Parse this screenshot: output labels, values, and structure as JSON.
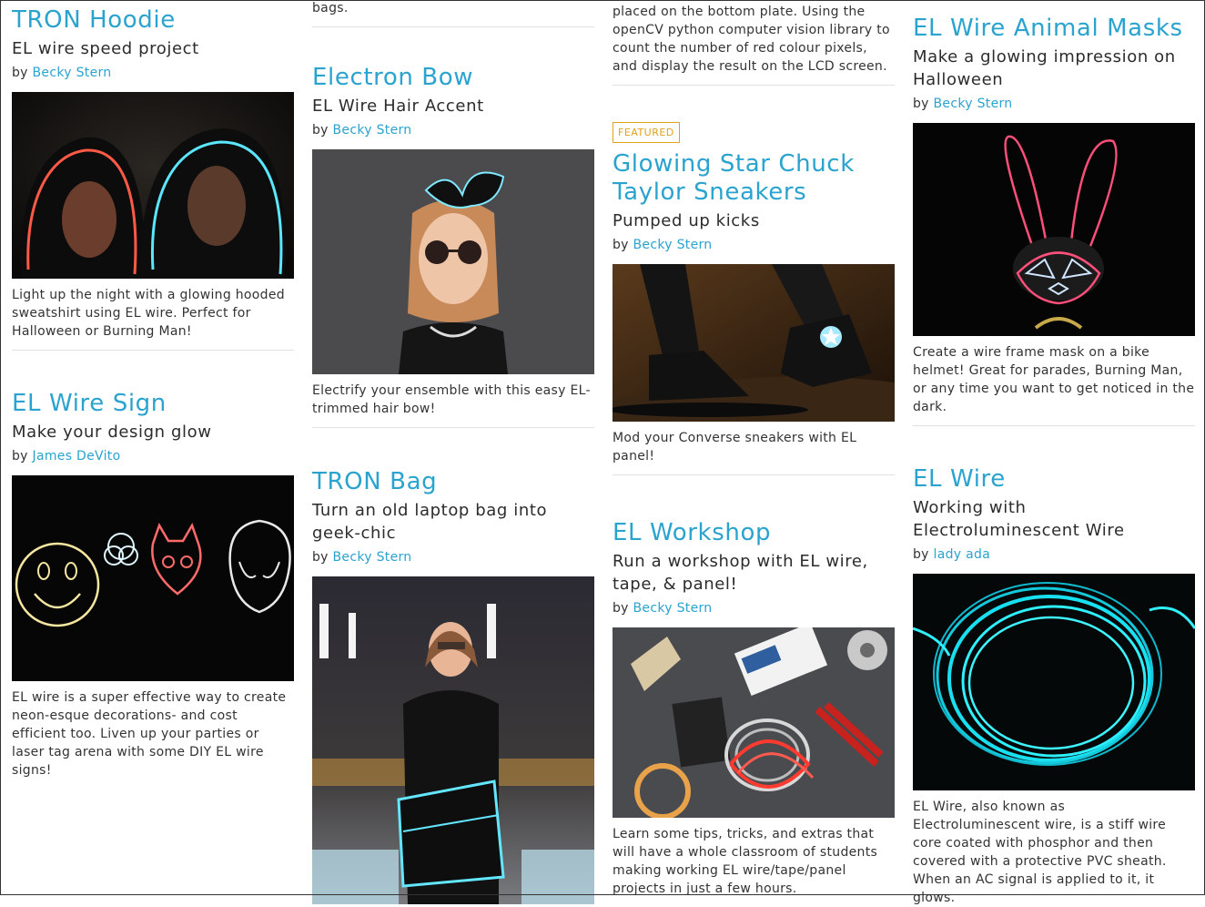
{
  "col1": {
    "card1": {
      "title": "TRON Hoodie",
      "subtitle": "EL wire speed project",
      "by": "by ",
      "author": "Becky Stern",
      "photo": "tron-hoodie-photo",
      "desc": "Light up the night with a glowing hooded sweatshirt using EL wire. Perfect for Halloween or Burning Man!"
    },
    "card2": {
      "title": "EL Wire Sign",
      "subtitle": "Make your design glow",
      "by": "by ",
      "author": "James DeVito",
      "photo": "el-wire-sign-photo",
      "desc": "EL wire is a super effective way to create neon-esque decorations- and cost efficient too. Liven up your parties or laser tag arena with some DIY EL wire signs!"
    }
  },
  "col2": {
    "top_fragment": "bags.",
    "card1": {
      "title": "Electron Bow",
      "subtitle": "EL Wire Hair Accent",
      "by": "by ",
      "author": "Becky Stern",
      "photo": "electron-bow-photo",
      "desc": "Electrify your ensemble with this easy EL-trimmed hair bow!"
    },
    "card2": {
      "title": "TRON Bag",
      "subtitle": "Turn an old laptop bag into geek-chic",
      "by": "by ",
      "author": "Becky Stern",
      "photo": "tron-bag-photo"
    }
  },
  "col3": {
    "top_fragment": "placed on the bottom plate. Using the openCV python computer vision library to count the number of red colour pixels, and display the result on the LCD screen.",
    "card1": {
      "badge": "FEATURED",
      "title": "Glowing Star Chuck Taylor Sneakers",
      "subtitle": "Pumped up kicks",
      "by": "by ",
      "author": "Becky Stern",
      "photo": "sneakers-photo",
      "desc": "Mod your Converse sneakers with EL panel!"
    },
    "card2": {
      "title": "EL Workshop",
      "subtitle": "Run a workshop with EL wire, tape, & panel!",
      "by": "by ",
      "author": "Becky Stern",
      "photo": "workshop-photo",
      "desc": "Learn some tips, tricks, and extras that will have a whole classroom of students making working EL wire/tape/panel projects in just a few hours."
    }
  },
  "col4": {
    "card1": {
      "title": "EL Wire Animal Masks",
      "subtitle": "Make a glowing impression on Halloween",
      "by": "by ",
      "author": "Becky Stern",
      "photo": "animal-mask-photo",
      "desc": "Create a wire frame mask on a bike helmet! Great for parades, Burning Man, or any time you want to get noticed in the dark."
    },
    "card2": {
      "title": "EL Wire",
      "subtitle": "Working with Electroluminescent Wire",
      "by": "by ",
      "author": "lady ada",
      "photo": "el-wire-coil-photo",
      "desc": "EL Wire, also known as Electroluminescent wire, is a stiff wire core coated with phosphor and then covered with a protective PVC sheath. When an AC signal is applied to it, it glows."
    }
  }
}
